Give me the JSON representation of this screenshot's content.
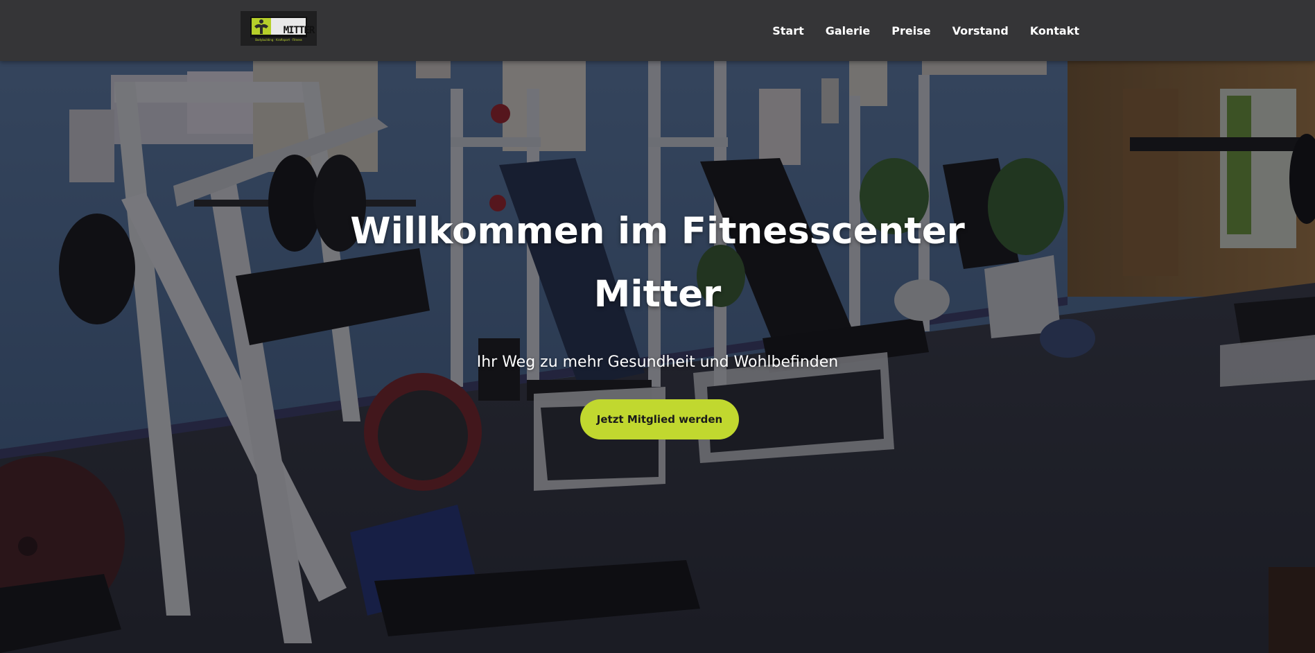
{
  "brand": {
    "logo_text": "MITTER",
    "logo_tagline": "Bodybuilding · Kraftsport · Fitness",
    "accent_color": "#c1d82f",
    "header_color": "#353537"
  },
  "nav": {
    "items": [
      {
        "label": "Start"
      },
      {
        "label": "Galerie"
      },
      {
        "label": "Preise"
      },
      {
        "label": "Vorstand"
      },
      {
        "label": "Kontakt"
      }
    ]
  },
  "hero": {
    "title": "Willkommen im Fitnesscenter Mitter",
    "subtitle": "Ihr Weg zu mehr Gesundheit und Wohlbefinden",
    "cta_label": "Jetzt Mitglied werden",
    "background_description_icon": "gym-interior-photo"
  }
}
